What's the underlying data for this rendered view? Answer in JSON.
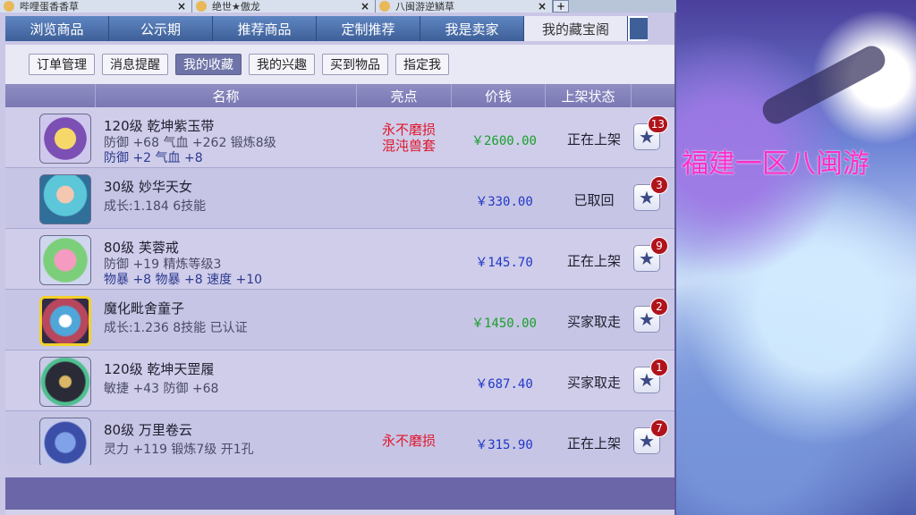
{
  "window_tabs": [
    {
      "label": "哔哩蛋香香草",
      "close": "×"
    },
    {
      "label": "绝世★傲龙",
      "close": "×"
    },
    {
      "label": "八闽游逆鳞草",
      "close": "×"
    }
  ],
  "window_tab_add": "+",
  "main_tabs": [
    "浏览商品",
    "公示期",
    "推荐商品",
    "定制推荐",
    "我是卖家",
    "我的藏宝阁"
  ],
  "sub_tabs": [
    "订单管理",
    "消息提醒",
    "我的收藏",
    "我的兴趣",
    "买到物品",
    "指定我"
  ],
  "table_headers": {
    "name": "名称",
    "highlight": "亮点",
    "price": "价钱",
    "status": "上架状态"
  },
  "items": [
    {
      "line1": "120级 乾坤紫玉带",
      "line2": "防御 +68 气血 +262 锻炼8级",
      "line3": "防御 +2 气血 +8",
      "highlight": "永不磨损\n混沌兽套",
      "price": "￥2600.00",
      "price_color": "green",
      "status": "正在上架",
      "count": "13",
      "icon": "belt-icon"
    },
    {
      "line1": "30级 妙华天女",
      "line2": "成长:1.184 6技能",
      "line3": "",
      "highlight": "",
      "price": "￥330.00",
      "price_color": "blue",
      "status": "已取回",
      "count": "3",
      "icon": "fairy-icon"
    },
    {
      "line1": "80级 芙蓉戒",
      "line2": "防御 +19 精炼等级3",
      "line3": "物暴 +8 物暴 +8 速度 +10",
      "highlight": "",
      "price": "￥145.70",
      "price_color": "blue",
      "status": "正在上架",
      "count": "9",
      "icon": "ring-icon"
    },
    {
      "line1": "魔化毗舍童子",
      "line2": "成长:1.236 8技能 已认证",
      "line3": "",
      "highlight": "",
      "price": "￥1450.00",
      "price_color": "green",
      "status": "买家取走",
      "count": "2",
      "icon": "pet-icon"
    },
    {
      "line1": "120级 乾坤天罡履",
      "line2": "敏捷 +43 防御 +68",
      "line3": "",
      "highlight": "",
      "price": "￥687.40",
      "price_color": "blue",
      "status": "买家取走",
      "count": "1",
      "icon": "boots-icon"
    },
    {
      "line1": "80级 万里卷云",
      "line2": "灵力 +119 锻炼7级 开1孔",
      "line3": "",
      "highlight": "永不磨损",
      "price": "￥315.90",
      "price_color": "blue",
      "status": "正在上架",
      "count": "7",
      "icon": "cloud-icon"
    }
  ],
  "side_caption": "福建一区八闽游",
  "colors": {
    "green": "#19a02c",
    "blue": "#2037c8",
    "red": "#e0162a"
  }
}
